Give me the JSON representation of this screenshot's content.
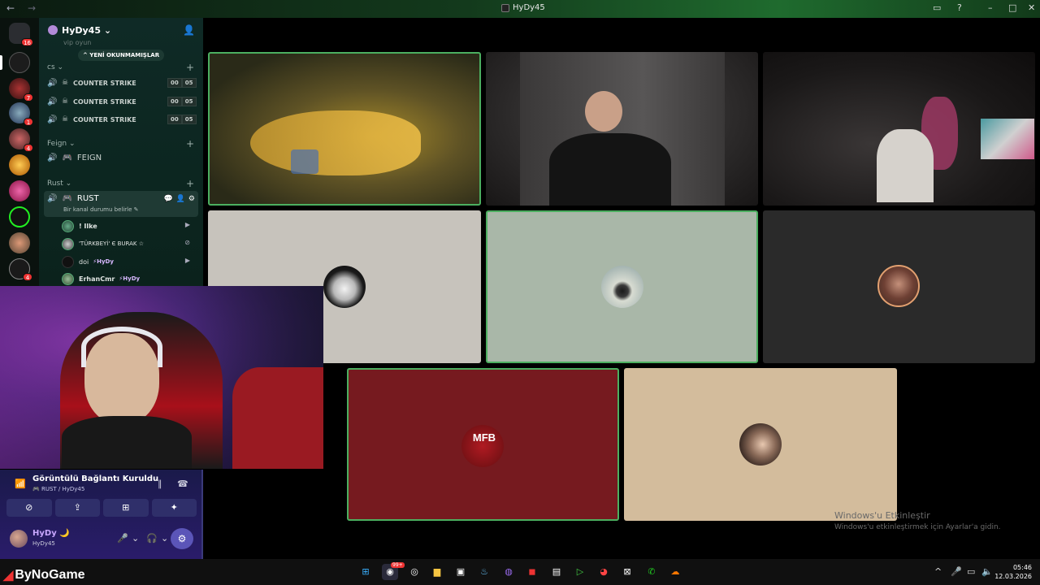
{
  "window": {
    "title": "HyDy45",
    "back": "←",
    "forward": "→",
    "inbox": "▭",
    "help": "?",
    "minimize": "–",
    "maximize": "□",
    "close": "✕"
  },
  "server": {
    "name": "HyDy45",
    "chevron": "⌄",
    "new_unread": "^ YENİ OKUNMAMIŞLAR",
    "top_channel": "vip oyun"
  },
  "rail_badges": [
    "16",
    "7",
    "1",
    "4",
    "4"
  ],
  "categories": {
    "cs": {
      "label": "cs ⌄",
      "plus": "+"
    },
    "feign": {
      "label": "Feign ⌄",
      "plus": "+"
    },
    "rust": {
      "label": "Rust ⌄",
      "plus": "+"
    }
  },
  "cs_channels": [
    {
      "name": "COUNTER STRIKE",
      "a": "00",
      "b": "05"
    },
    {
      "name": "COUNTER STRIKE",
      "a": "00",
      "b": "05"
    },
    {
      "name": "COUNTER STRIKE",
      "a": "00",
      "b": "05"
    }
  ],
  "feign_channel": "FEIGN",
  "rust_channel": {
    "name": "RUST",
    "status": "Bir kanal durumu belirle ✎"
  },
  "members": [
    {
      "name": "! Ilke",
      "tag": ""
    },
    {
      "name": "'TÜRKBEYİ' Є BURAK ☆",
      "tag": ""
    },
    {
      "name": "doi",
      "tag": "⚡HyDy"
    },
    {
      "name": "ErhanCmr",
      "tag": "⚡HyDy"
    }
  ],
  "voice_panel": {
    "connected": "Görüntülü Bağlantı Kuruldu",
    "channel": "RUST / HyDy45",
    "buttons": [
      "⊘",
      "⇪",
      "⊞",
      "✦"
    ],
    "username": "HyDy 🌙",
    "user_sub": "HyDy45",
    "mic": "🎤",
    "headset": "🎧",
    "settings": "⚙"
  },
  "tiles": {
    "mfb_logo": "MFB"
  },
  "watermark": {
    "line1": "Windows'u Etkinleştir",
    "line2": "Windows'u etkinleştirmek için Ayarlar'a gidin."
  },
  "brand": "ByNoGame",
  "clock": {
    "time": "05:46",
    "date": "12.03.2026"
  },
  "taskbar_notification": "99+",
  "colors": {
    "speaking": "#4caf60",
    "mfb_bg": "#761a1f",
    "accent": "#5b55b8"
  }
}
